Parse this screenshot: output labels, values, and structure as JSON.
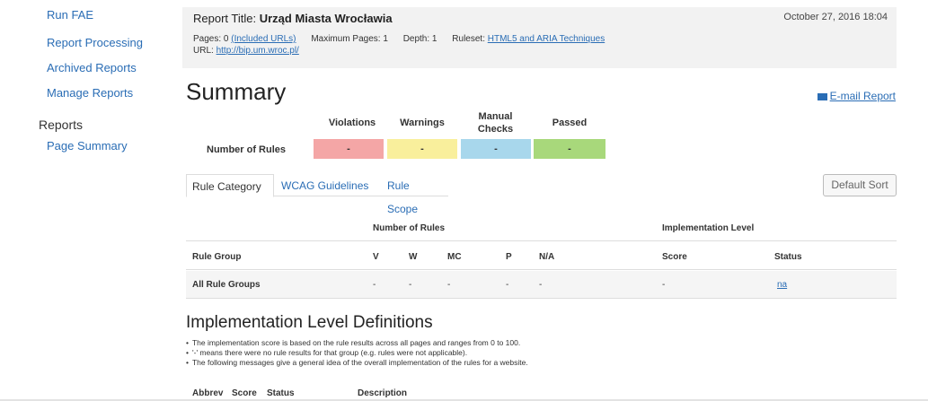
{
  "sidebar": {
    "nav": [
      {
        "label": "Run FAE"
      },
      {
        "label": "Report Processing"
      },
      {
        "label": "Archived Reports"
      },
      {
        "label": "Manage Reports"
      }
    ],
    "section_label": "Reports",
    "sub_items": [
      {
        "label": "Page Summary"
      }
    ]
  },
  "report": {
    "title_prefix": "Report Title:",
    "title": "Urząd Miasta Wrocławia",
    "date": "October 27, 2016 18:04",
    "pages_label": "Pages: 0",
    "included_urls": "(Included URLs)",
    "max_pages": "Maximum Pages: 1",
    "depth": "Depth: 1",
    "ruleset_label": "Ruleset:",
    "ruleset": "HTML5 and ARIA Techniques",
    "url_label": "URL:",
    "url": "http://bip.um.wroc.pl/"
  },
  "summary": {
    "title": "Summary",
    "email_label": "E-mail Report",
    "headers": {
      "violations": "Violations",
      "warnings": "Warnings",
      "manual_1": "Manual",
      "manual_2": "Checks",
      "passed": "Passed"
    },
    "row_label": "Number of Rules",
    "values": {
      "violations": "-",
      "warnings": "-",
      "manual": "-",
      "passed": "-"
    },
    "colors": {
      "violations": "#f4a6a6",
      "warnings": "#f9ef9c",
      "manual": "#a8d7ec",
      "passed": "#a8d87b"
    }
  },
  "tabs": [
    {
      "label": "Rule Category"
    },
    {
      "label": "WCAG Guidelines"
    },
    {
      "label": "Rule Scope"
    }
  ],
  "default_sort_label": "Default Sort",
  "rules_table": {
    "group_head_number": "Number of Rules",
    "group_head_impl": "Implementation Level",
    "columns": {
      "rule_group": "Rule Group",
      "v": "V",
      "w": "W",
      "mc": "MC",
      "p": "P",
      "na": "N/A",
      "score": "Score",
      "status": "Status"
    },
    "row": {
      "rule_group": "All Rule Groups",
      "v": "-",
      "w": "-",
      "mc": "-",
      "p": "-",
      "na": "-",
      "score": "-",
      "status": "na"
    }
  },
  "definitions": {
    "title": "Implementation Level Definitions",
    "items": [
      "The implementation score is based on the rule results across all pages and ranges from 0 to 100.",
      "'-' means there were no rule results for that group (e.g. rules were not applicable).",
      "The following messages give a general idea of the overall implementation of the rules for a website."
    ],
    "columns": {
      "abbrev": "Abbrev",
      "score": "Score",
      "status": "Status",
      "description": "Description"
    }
  }
}
